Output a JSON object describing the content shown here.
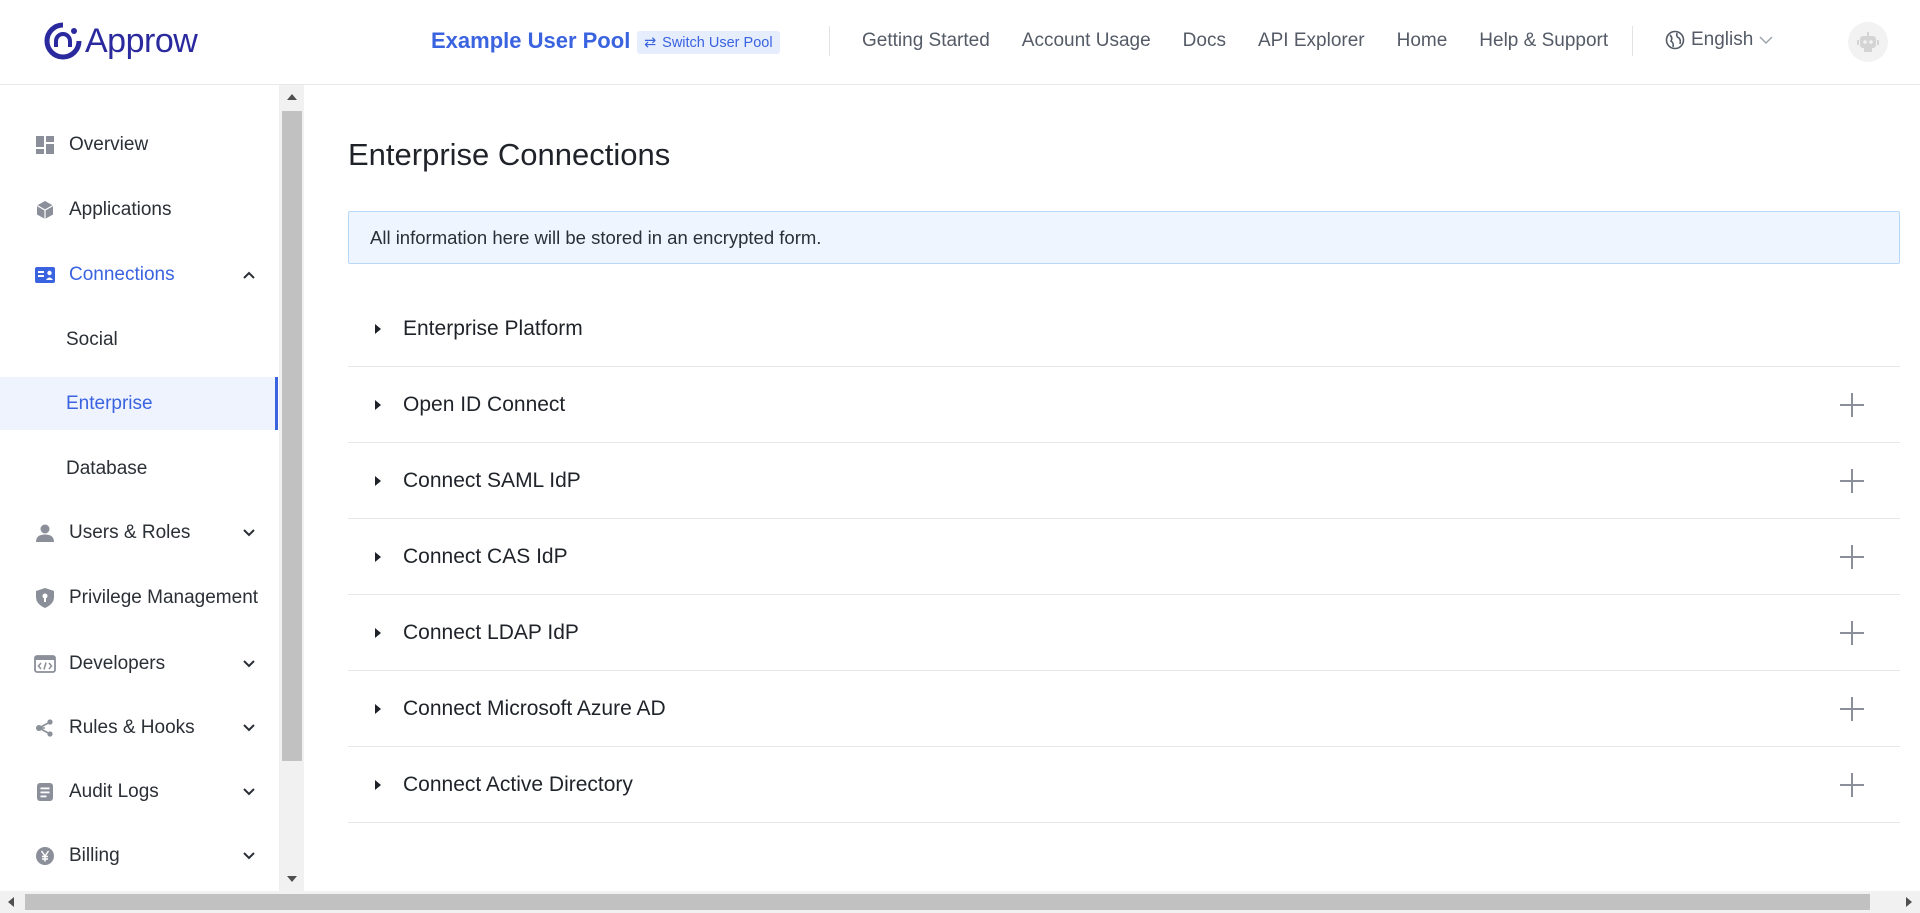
{
  "header": {
    "logo_text": "Approw",
    "pool_name": "Example User Pool",
    "switch_pool_label": "Switch User Pool",
    "nav": [
      "Getting Started",
      "Account Usage",
      "Docs",
      "API Explorer",
      "Home",
      "Help & Support"
    ],
    "language": "English"
  },
  "sidebar": {
    "items": [
      {
        "label": "Overview",
        "icon": "dashboard-icon"
      },
      {
        "label": "Applications",
        "icon": "cube-icon"
      },
      {
        "label": "Connections",
        "icon": "id-card-icon",
        "expanded": true
      },
      {
        "label": "Users & Roles",
        "icon": "user-icon"
      },
      {
        "label": "Privilege Management",
        "icon": "shield-icon"
      },
      {
        "label": "Developers",
        "icon": "code-window-icon"
      },
      {
        "label": "Rules & Hooks",
        "icon": "share-nodes-icon"
      },
      {
        "label": "Audit Logs",
        "icon": "document-icon"
      },
      {
        "label": "Billing",
        "icon": "yen-coin-icon"
      }
    ],
    "connections_sub": [
      "Social",
      "Enterprise",
      "Database"
    ],
    "selected_sub": "Enterprise"
  },
  "main": {
    "title": "Enterprise Connections",
    "info": "All information here will be stored in an encrypted form.",
    "connections": [
      {
        "name": "Enterprise Platform",
        "addable": false
      },
      {
        "name": "Open ID Connect",
        "addable": true
      },
      {
        "name": "Connect SAML IdP",
        "addable": true
      },
      {
        "name": "Connect CAS IdP",
        "addable": true
      },
      {
        "name": "Connect LDAP IdP",
        "addable": true
      },
      {
        "name": "Connect Microsoft Azure AD",
        "addable": true
      },
      {
        "name": "Connect Active Directory",
        "addable": true
      }
    ]
  },
  "colors": {
    "accent": "#3a63e0",
    "logo": "#2a2a9e",
    "info_bg": "#eef5ff",
    "info_border": "#b9d6fb"
  }
}
